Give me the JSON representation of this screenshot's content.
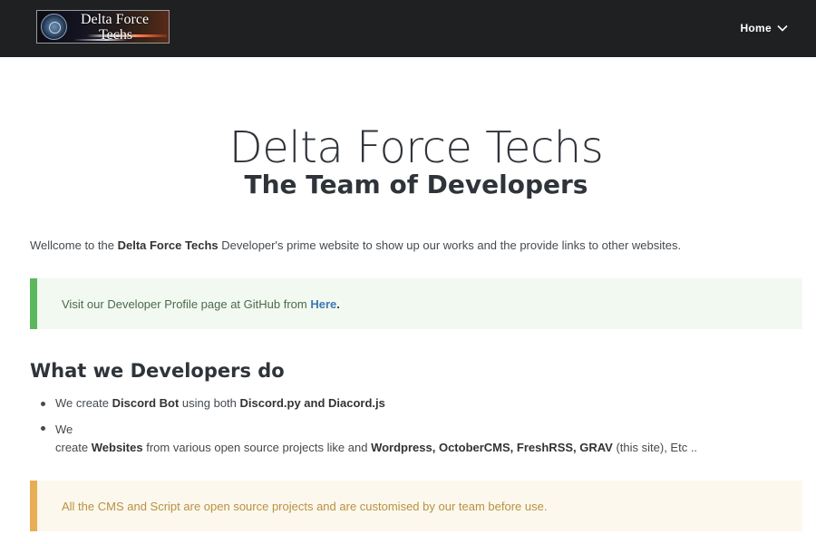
{
  "header": {
    "logo": {
      "line1": "Delta Force",
      "line2": "Techs"
    },
    "nav_home": "Home"
  },
  "hero": {
    "title": "Delta Force Techs",
    "subtitle": "The Team of Developers"
  },
  "intro": {
    "prefix": "Wellcome to the ",
    "bold": "Delta Force Techs",
    "suffix": " Developer's prime website to show up our works and the provide links to other websites."
  },
  "note_green": {
    "text": "Visit our Developer Profile page at GitHub from ",
    "link": "Here",
    "end": "."
  },
  "section": {
    "heading": "What we Developers do",
    "items": [
      {
        "t1": "We create ",
        "b1": "Discord Bot",
        "t2": " using both ",
        "b2": "Discord.py and Diacord.js"
      },
      {
        "t1": "We",
        "t2": "create ",
        "b1": "Websites",
        "t3": " from various open source projects like and ",
        "b2": "Wordpress, OctoberCMS, FreshRSS, GRAV",
        "t4": " (this site), Etc .."
      }
    ]
  },
  "note_yellow": {
    "text": "All the CMS and Script are open source projects and are customised by our team before use."
  },
  "colors": {
    "topbar": "#1f2022",
    "green_accent": "#5cb85c",
    "yellow_accent": "#e8ad55",
    "link": "#3c78b5"
  },
  "icons": {
    "nav_chevron": "chevron-down-icon",
    "logo_emblem": "emblem-icon"
  }
}
